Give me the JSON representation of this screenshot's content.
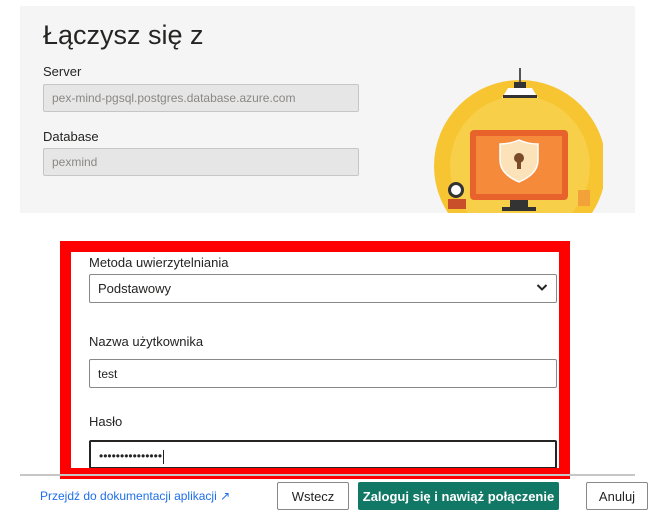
{
  "header": {
    "title": "Łączysz się z",
    "server_label": "Server",
    "server_value": "pex-mind-pgsql.postgres.database.azure.com",
    "database_label": "Database",
    "database_value": "pexmind"
  },
  "auth": {
    "method_label": "Metoda uwierzytelniania",
    "method_value": "Podstawowy",
    "username_label": "Nazwa użytkownika",
    "username_value": "test",
    "password_label": "Hasło",
    "password_value": "•••••••••••••••"
  },
  "footer": {
    "doc_link": "Przejdź do dokumentacji aplikacji ↗",
    "back_label": "Wstecz",
    "signin_label": "Zaloguj się i nawiąż połączenie",
    "cancel_label": "Anuluj"
  },
  "colors": {
    "accent": "#117865",
    "highlight": "#ff0000",
    "link": "#1f6feb"
  }
}
